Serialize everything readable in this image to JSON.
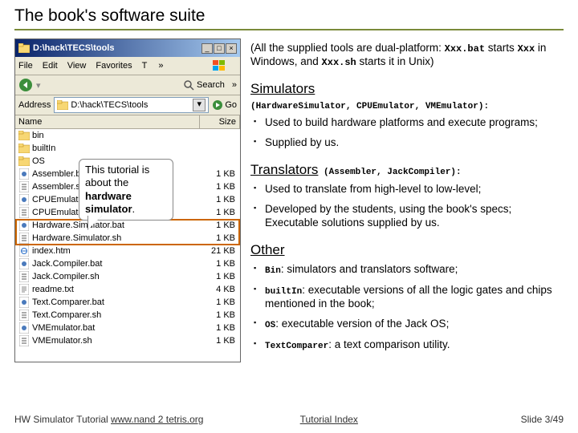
{
  "slide": {
    "title": "The book's software suite",
    "intro": {
      "pre": "(All the supplied tools are dual-platform: ",
      "c1": "Xxx.bat",
      "mid1": " starts ",
      "c2": "Xxx",
      "mid2": " in Windows, and ",
      "c3": "Xxx.sh",
      "post": " starts it in Unix)"
    },
    "simulators": {
      "heading": "Simulators",
      "codes": "(HardwareSimulator, CPUEmulator, VMEmulator):",
      "b1": "Used to build hardware platforms and execute programs;",
      "b2": "Supplied by us."
    },
    "translators": {
      "heading": "Translators",
      "codes": " (Assembler, JackCompiler):",
      "b1": "Used to translate from high-level to low-level;",
      "b2": "Developed by the students, using the book's specs; Executable solutions supplied by us."
    },
    "other": {
      "heading": "Other",
      "b1a": "Bin",
      "b1b": ": simulators and translators software;",
      "b2a": "builtIn",
      "b2b": ": executable versions of all the logic gates and chips mentioned in the book;",
      "b3a": "OS",
      "b3b": ": executable version of the Jack OS;",
      "b4a": "TextComparer",
      "b4b": ": a text comparison utility."
    }
  },
  "callout": {
    "l1": "This tutorial is",
    "l2": "about the",
    "l3": "hardware simulator",
    "l4": "."
  },
  "explorer": {
    "title": "D:\\hack\\TECS\\tools",
    "menu": {
      "file": "File",
      "edit": "Edit",
      "view": "View",
      "favorites": "Favorites",
      "t": "T",
      "chev": "»"
    },
    "toolbar": {
      "back": "",
      "search": "Search",
      "chev": "»"
    },
    "address": {
      "label": "Address",
      "path": "D:\\hack\\TECS\\tools",
      "go": "Go"
    },
    "cols": {
      "name": "Name",
      "size": "Size"
    },
    "files": [
      {
        "icon": "folder",
        "name": "bin",
        "size": ""
      },
      {
        "icon": "folder",
        "name": "builtIn",
        "size": ""
      },
      {
        "icon": "folder",
        "name": "OS",
        "size": ""
      },
      {
        "icon": "bat",
        "name": "Assembler.bat",
        "size": "1 KB"
      },
      {
        "icon": "sh",
        "name": "Assembler.sh",
        "size": "1 KB"
      },
      {
        "icon": "bat",
        "name": "CPUEmulator.bat",
        "size": "1 KB"
      },
      {
        "icon": "sh",
        "name": "CPUEmulator.sh",
        "size": "1 KB"
      },
      {
        "icon": "bat",
        "name": "Hardware.Simulator.bat",
        "size": "1 KB"
      },
      {
        "icon": "sh",
        "name": "Hardware.Simulator.sh",
        "size": "1 KB"
      },
      {
        "icon": "htm",
        "name": "index.htm",
        "size": "21 KB"
      },
      {
        "icon": "bat",
        "name": "Jack.Compiler.bat",
        "size": "1 KB"
      },
      {
        "icon": "sh",
        "name": "Jack.Compiler.sh",
        "size": "1 KB"
      },
      {
        "icon": "txt",
        "name": "readme.txt",
        "size": "4 KB"
      },
      {
        "icon": "bat",
        "name": "Text.Comparer.bat",
        "size": "1 KB"
      },
      {
        "icon": "sh",
        "name": "Text.Comparer.sh",
        "size": "1 KB"
      },
      {
        "icon": "bat",
        "name": "VMEmulator.bat",
        "size": "1 KB"
      },
      {
        "icon": "sh",
        "name": "VMEmulator.sh",
        "size": "1 KB"
      }
    ]
  },
  "footer": {
    "left_a": "HW Simulator Tutorial ",
    "left_link": "www.nand 2 tetris.org",
    "mid": "Tutorial Index",
    "right": "Slide 3/49"
  }
}
